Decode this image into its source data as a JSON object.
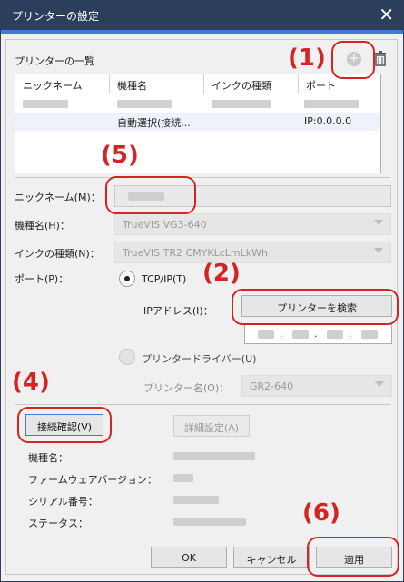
{
  "window": {
    "title": "プリンターの設定",
    "close_icon": "close-icon"
  },
  "printer_list": {
    "label": "プリンターの一覧",
    "columns": [
      "ニックネーム",
      "機種名",
      "インクの種類",
      "ポート"
    ],
    "rows": [
      {
        "nickname": "",
        "model": "",
        "ink": "",
        "port": ""
      },
      {
        "nickname": "",
        "model": "自動選択(接続...",
        "ink": "",
        "port": "IP:0.0.0.0"
      }
    ],
    "add_icon": "plus-circle-icon",
    "delete_icon": "trash-icon"
  },
  "form": {
    "nickname_label": "ニックネーム(M)：",
    "model_label": "機種名(H)：",
    "model_value": "TrueVIS VG3-640",
    "ink_label": "インクの種類(N)：",
    "ink_value": "TrueVIS TR2 CMYKLcLmLkWh",
    "port_label": "ポート(P)：",
    "tcpip_label": "TCP/IP(T)",
    "ip_label": "IPアドレス(I)：",
    "search_button": "プリンターを検索",
    "ip_dots": [
      ".",
      ".",
      "."
    ],
    "driver_label": "プリンタードライバー(U)",
    "printer_name_label": "プリンター名(O)：",
    "printer_name_value": "GR2-640"
  },
  "connection": {
    "check_button": "接続確認(V)",
    "detail_button": "詳細設定(A)",
    "info_labels": [
      "機種名：",
      "ファームウェアバージョン：",
      "シリアル番号：",
      "ステータス："
    ]
  },
  "footer": {
    "ok": "OK",
    "cancel": "キャンセル",
    "apply": "適用"
  },
  "callouts": {
    "c1": "(1)",
    "c2": "(2)",
    "c4": "(4)",
    "c5": "(5)",
    "c6": "(6)"
  },
  "colors": {
    "titlebar": "#2b3e5c",
    "accent": "#3d7bd9",
    "callout": "#d42525"
  }
}
